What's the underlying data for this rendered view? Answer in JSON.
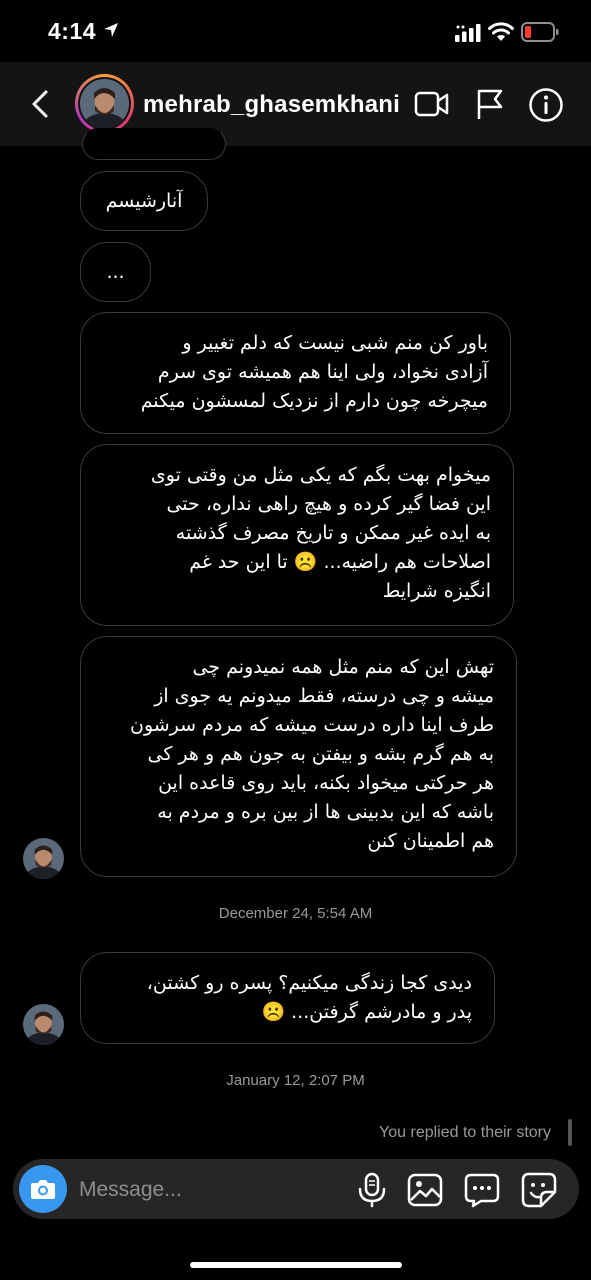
{
  "status_bar": {
    "time": "4:14"
  },
  "header": {
    "username": "mehrab_ghasemkhani"
  },
  "messages": [
    {
      "id": "m1",
      "text": "آنارشیسم"
    },
    {
      "id": "m2",
      "text": "..."
    },
    {
      "id": "m3",
      "text": "باور کن منم شبی نیست که دلم تغییر و\nآزادی نخواد، ولی اینا هم همیشه توی سرم\nمیچرخه چون دارم از نزدیک لمسشون میکنم"
    },
    {
      "id": "m4",
      "text": "میخوام بهت بگم که یکی مثل من وقتی توی\nاین فضا گیر کرده و هیچ راهی نداره، حتی\nبه ایده غیر ممکن و تاریخ مصرف گذشته\nاصلاحات هم راضیه... ☹️ تا این حد غم\nانگیزه شرایط"
    },
    {
      "id": "m5",
      "text": "تهش این که منم مثل همه نمیدونم چی\nمیشه و چی درسته، فقط میدونم یه جوی از\nطرف اینا داره درست میشه که مردم سرشون\nبه هم گرم بشه و بیفتن به جون هم و هر کی\nهر حرکتی میخواد بکنه، باید روی قاعده این\nباشه که این بدبینی ها از بین بره و مردم به\nهم اطمینان کنن"
    },
    {
      "id": "m6",
      "text": "دیدی کجا زندگی میکنیم؟ پسره رو کشتن،\nپدر و مادرشم گرفتن... ☹️"
    }
  ],
  "timestamps": [
    "December 24, 5:54 AM",
    "January 12, 2:07 PM"
  ],
  "reply_note": "You replied to their story",
  "composer": {
    "placeholder": "Message..."
  },
  "colors": {
    "background": "#000000",
    "header": "#141414",
    "bubble_border": "#3a3a3a",
    "camera_button": "#3897f0",
    "battery_low": "#ff3b30"
  }
}
